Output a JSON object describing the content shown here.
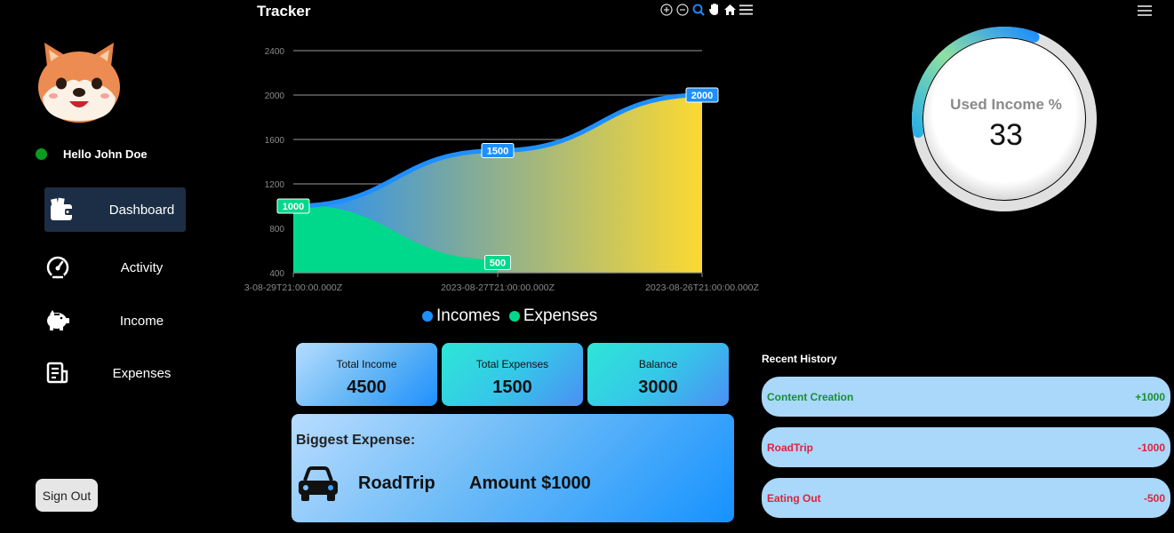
{
  "user": {
    "greeting": "Hello John Doe"
  },
  "nav": {
    "items": [
      {
        "label": "Dashboard",
        "icon": "wallet-icon",
        "active": true
      },
      {
        "label": "Activity",
        "icon": "speedometer-icon",
        "active": false
      },
      {
        "label": "Income",
        "icon": "piggy-bank-icon",
        "active": false
      },
      {
        "label": "Expenses",
        "icon": "receipt-icon",
        "active": false
      }
    ],
    "signout_label": "Sign Out"
  },
  "chart": {
    "title": "Tracker",
    "toolbar": [
      "zoom-in-icon",
      "zoom-out-icon",
      "zoom-select-icon",
      "pan-hand-icon",
      "home-reset-icon",
      "menu-icon"
    ]
  },
  "chart_data": {
    "type": "area",
    "title": "Tracker",
    "x": [
      "3-08-29T21:00:00.000Z",
      "2023-08-27T21:00:00.000Z",
      "2023-08-26T21:00:00.000Z"
    ],
    "ylim": [
      400,
      2400
    ],
    "yticks": [
      400,
      800,
      1200,
      1600,
      2000,
      2400
    ],
    "grid": true,
    "legend_position": "bottom",
    "series": [
      {
        "name": "Incomes",
        "values": [
          1000,
          1500,
          2000
        ],
        "labels": [
          "1000",
          "1500",
          "2000"
        ],
        "color": "#1e8fff"
      },
      {
        "name": "Expenses",
        "values": [
          1000,
          500,
          null
        ],
        "labels": [
          "1000",
          "500"
        ],
        "color": "#00d98b"
      }
    ]
  },
  "radial": {
    "label": "Used Income %",
    "value": "33",
    "percent": 33
  },
  "stats": {
    "income": {
      "label": "Total Income",
      "value": "4500"
    },
    "expenses": {
      "label": "Total Expenses",
      "value": "1500"
    },
    "balance": {
      "label": "Balance",
      "value": "3000"
    }
  },
  "biggest": {
    "title": "Biggest Expense:",
    "name": "RoadTrip",
    "amount_label": "Amount $1000"
  },
  "history": {
    "title": "Recent History",
    "items": [
      {
        "name": "Content Creation",
        "amount": "+1000",
        "type": "income"
      },
      {
        "name": "RoadTrip",
        "amount": "-1000",
        "type": "expense"
      },
      {
        "name": "Eating Out",
        "amount": "-500",
        "type": "expense"
      }
    ]
  }
}
